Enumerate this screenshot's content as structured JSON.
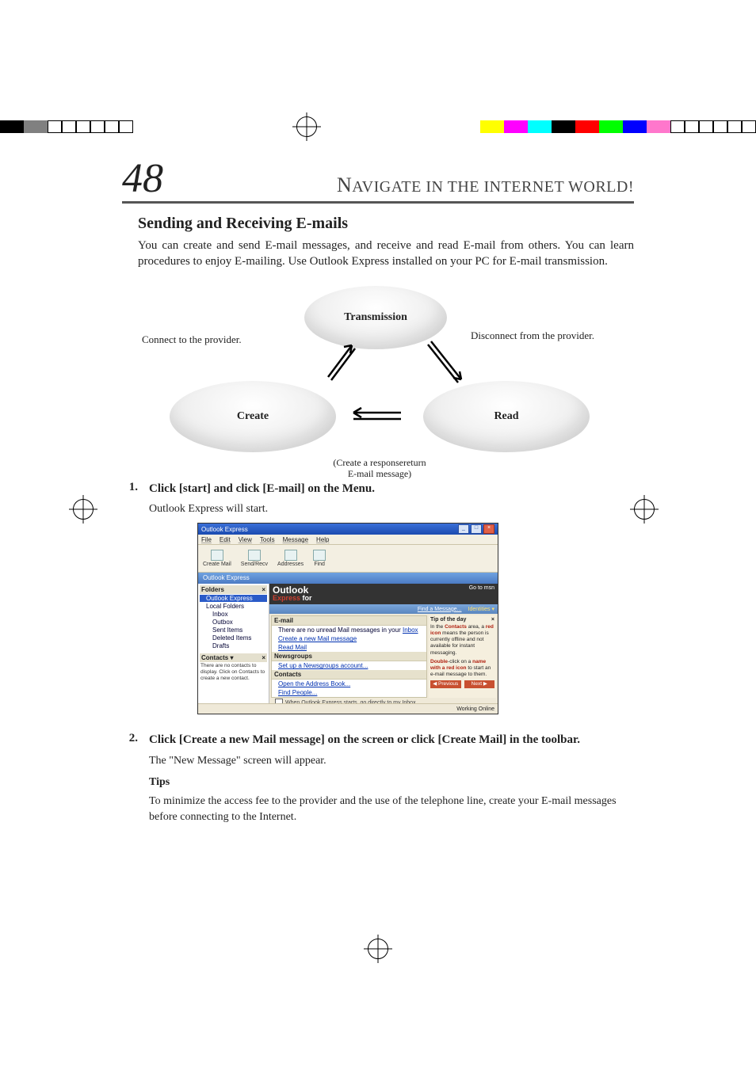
{
  "page_number": "48",
  "chapter_title_prefix": "N",
  "chapter_title_rest": "AVIGATE IN THE INTERNET WORLD!",
  "section_heading": "Sending and Receiving E-mails",
  "intro_paragraph": "You can create and send E-mail messages, and receive and read E-mail from others.  You can learn procedures to enjoy E-mailing. Use Outlook Express installed on your PC for E-mail transmission.",
  "diagram": {
    "bubble_top": "Transmission",
    "bubble_left": "Create",
    "bubble_right": "Read",
    "connect_label": "Connect to the provider.",
    "disconnect_label": "Disconnect from the provider.",
    "caption_line1": "(Create a responsereturn",
    "caption_line2": "E-mail message)"
  },
  "steps": {
    "s1_num": "1.",
    "s1_text": "Click [start] and click [E-mail] on the Menu.",
    "s1_sub": "Outlook Express will start.",
    "s2_num": "2.",
    "s2_text": "Click [Create a new Mail message] on the screen or click [Create Mail] in the toolbar.",
    "s2_sub": "The \"New Message\" screen will appear.",
    "tips_label": "Tips",
    "tips_text": "To minimize the access fee to the provider and the use of the telephone line, create your E-mail messages before connecting to the Internet."
  },
  "screenshot": {
    "window_title": "Outlook Express",
    "menus": [
      "File",
      "Edit",
      "View",
      "Tools",
      "Message",
      "Help"
    ],
    "tools": [
      "Create Mail",
      "Send/Recv",
      "Addresses",
      "Find"
    ],
    "blueband": "Outlook Express",
    "folders_header": "Folders",
    "folders": {
      "root": "Outlook Express",
      "local": "Local Folders",
      "inbox": "Inbox",
      "outbox": "Outbox",
      "sent": "Sent Items",
      "deleted": "Deleted Items",
      "drafts": "Drafts"
    },
    "contacts_header": "Contacts ▾",
    "contacts_msg": "There are no contacts to display. Click on Contacts to create a new contact.",
    "brand_line1": "Outlook",
    "brand_line2a": "Express",
    "brand_line2b": " for",
    "goto": "Go to msn",
    "strip_find": "Find a Message...",
    "strip_ident": "Identities ▾",
    "sections": {
      "email_h": "E-mail",
      "email_unread_a": "There are no unread Mail messages in your ",
      "email_unread_b": "Inbox",
      "email_create": "Create a new Mail message",
      "email_read": "Read Mail",
      "news_h": "Newsgroups",
      "news_setup": "Set up a Newsgroups account...",
      "contacts_h": "Contacts",
      "open_ab": "Open the Address Book...",
      "find_people": "Find People..."
    },
    "tip": {
      "header": "Tip of the day",
      "p1a": "In the ",
      "p1b": "Contacts",
      "p1c": " area, a ",
      "p1d": "red icon",
      "p1e": " means the person is currently offline and not available for instant messaging.",
      "p2a": "Double",
      "p2b": "-click on a ",
      "p2c": "name with a red icon",
      "p2d": " to start an e-mail message to them.",
      "prev": "◀ Previous",
      "next": "Next ▶"
    },
    "checkbox_label": "When Outlook Express starts, go directly to my Inbox.",
    "status": "Working Online"
  },
  "swatches_left": [
    "#000000",
    "#808080"
  ],
  "swatches_right": [
    "#ffff00",
    "#ff00ff",
    "#00ffff",
    "#000000",
    "#ff0000",
    "#00ff00",
    "#0000ff",
    "#ff77cc"
  ]
}
